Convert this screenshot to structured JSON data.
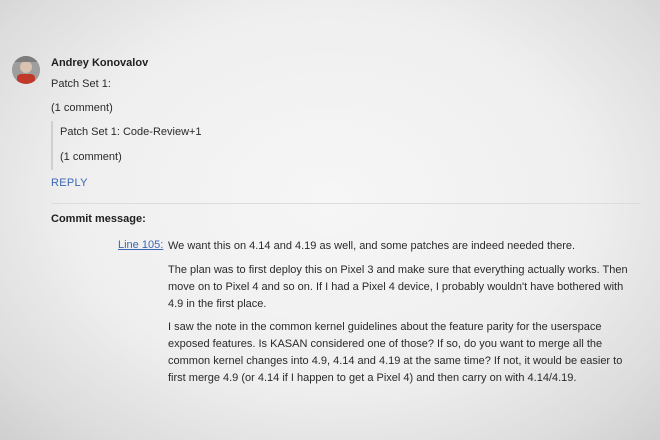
{
  "message": {
    "author": "Andrey Konovalov",
    "patch_set": "Patch Set 1:",
    "comment_count": "(1 comment)",
    "quoted": {
      "patch_set": "Patch Set 1: Code-Review+1",
      "comment_count": "(1 comment)"
    },
    "reply_label": "REPLY"
  },
  "commit_message": {
    "title": "Commit message:",
    "line_link": "Line 105:",
    "paragraphs": [
      "We want this on 4.14 and 4.19 as well, and some patches are indeed needed there.",
      "The plan was to first deploy this on Pixel 3 and make sure that everything actually works. Then move on to Pixel 4 and so on. If I had a Pixel 4 device, I probably wouldn't have bothered with 4.9 in the first place.",
      "I saw the note in the common kernel guidelines about the feature parity for the userspace exposed features. Is KASAN considered one of those? If so, do you want to merge all the common kernel changes into 4.9, 4.14 and 4.19 at the same time? If not, it would be easier to first merge 4.9 (or 4.14 if I happen to get a Pixel 4) and then carry on with 4.14/4.19."
    ]
  },
  "colors": {
    "link": "#3b66b3",
    "text": "#2a2a2a",
    "background": "#efefef"
  }
}
